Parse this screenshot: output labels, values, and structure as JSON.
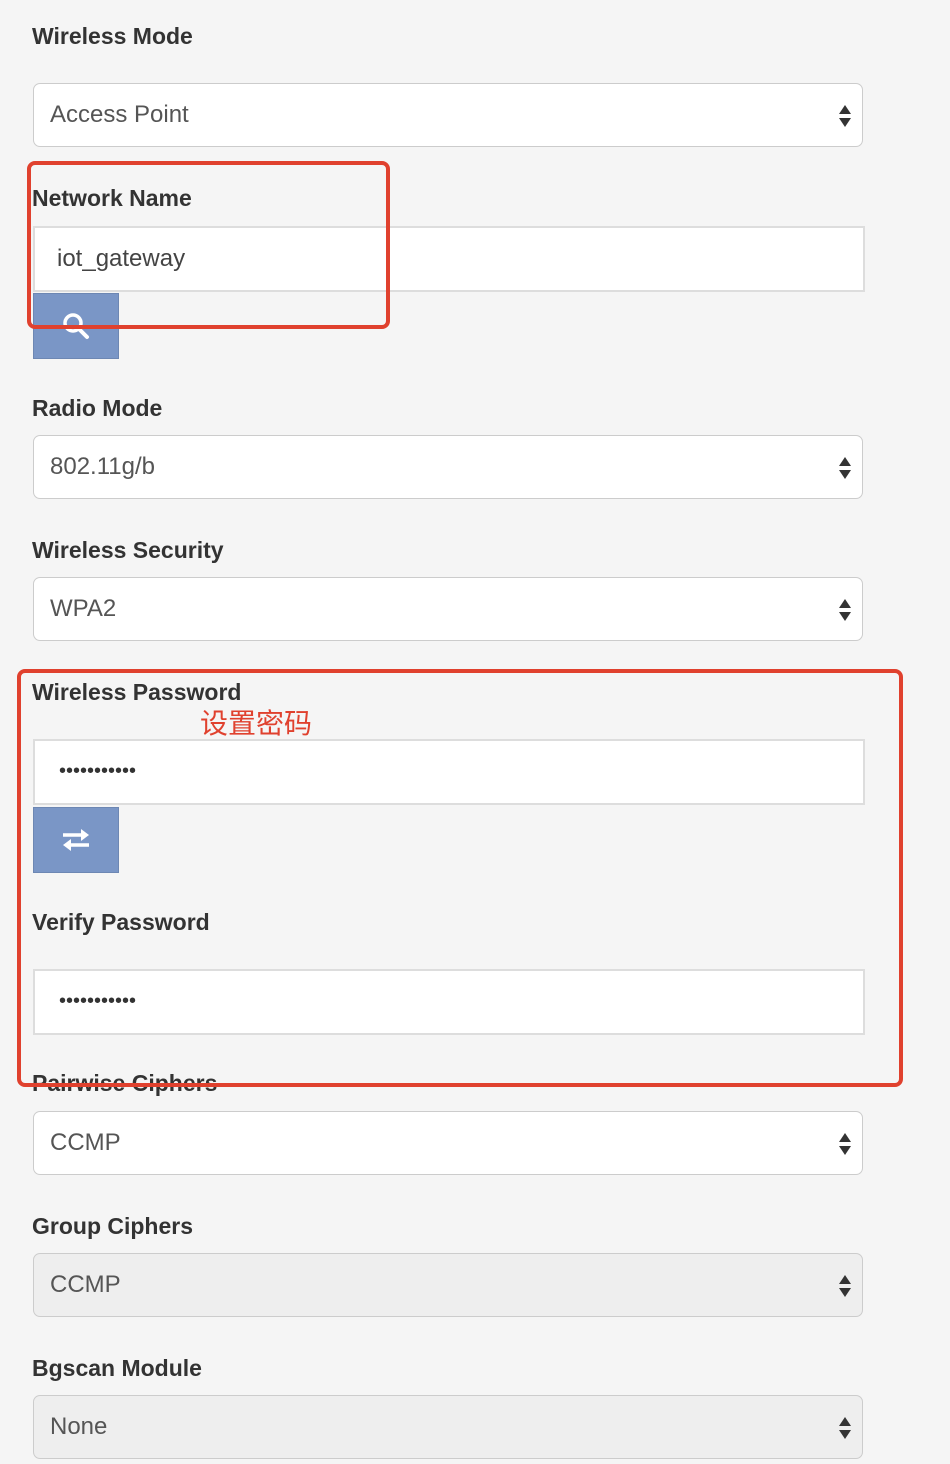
{
  "form": {
    "wireless_mode": {
      "label": "Wireless Mode",
      "selected": "Access Point"
    },
    "network_name": {
      "label": "Network Name",
      "value": "iot_gateway",
      "scan_button_icon": "search-icon"
    },
    "radio_mode": {
      "label": "Radio Mode",
      "selected": "802.11g/b"
    },
    "wireless_security": {
      "label": "Wireless Security",
      "selected": "WPA2"
    },
    "wireless_password": {
      "label": "Wireless Password",
      "masked_value": "•••••••••••",
      "toggle_button_icon": "swap-arrows-icon"
    },
    "verify_password": {
      "label": "Verify Password",
      "masked_value": "•••••••••••"
    },
    "pairwise_ciphers": {
      "label": "Pairwise Ciphers",
      "selected": "CCMP"
    },
    "group_ciphers": {
      "label": "Group Ciphers",
      "selected": "CCMP"
    },
    "bgscan_module": {
      "label": "Bgscan Module",
      "selected": "None"
    }
  },
  "annotations": {
    "password_note": "设置密码"
  },
  "colors": {
    "annotation_red": "#e0412e",
    "button_blue": "#7a96c6",
    "page_background": "#f5f5f5"
  }
}
